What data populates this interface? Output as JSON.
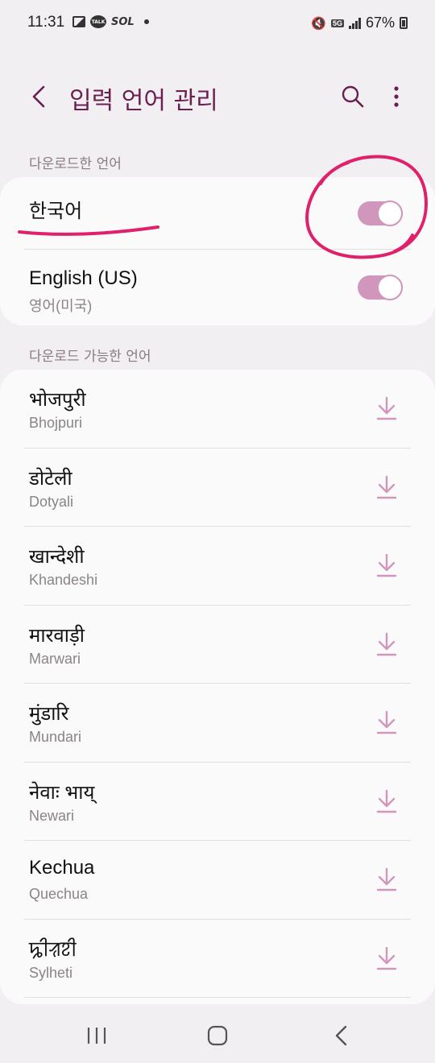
{
  "status_bar": {
    "time": "11:31",
    "left_icons": [
      "image-icon",
      "kakaotalk-icon",
      "sol-icon",
      "dot-icon"
    ],
    "talk_label": "TALK",
    "sol_label": "SOL",
    "network_label": "5G",
    "battery": "67%"
  },
  "header": {
    "title": "입력 언어 관리",
    "back_icon": "chevron-left-icon",
    "search_icon": "search-icon",
    "more_icon": "more-vertical-icon"
  },
  "downloaded": {
    "section_label": "다운로드한 언어",
    "items": [
      {
        "title": "한국어",
        "subtitle": "",
        "enabled": true
      },
      {
        "title": "English (US)",
        "subtitle": "영어(미국)",
        "enabled": true
      }
    ]
  },
  "available": {
    "section_label": "다운로드 가능한 언어",
    "items": [
      {
        "title": "भोजपुरी",
        "subtitle": "Bhojpuri"
      },
      {
        "title": "डोटेली",
        "subtitle": "Dotyali"
      },
      {
        "title": "खान्देशी",
        "subtitle": "Khandeshi"
      },
      {
        "title": "मारवाड़ी",
        "subtitle": "Marwari"
      },
      {
        "title": "मुंडारि",
        "subtitle": "Mundari"
      },
      {
        "title": "नेवाः भाय्",
        "subtitle": "Newari"
      },
      {
        "title": "Kechua",
        "subtitle": "Quechua"
      },
      {
        "title": "ꠍꠤꠟꠐꠤ",
        "subtitle": "Sylheti"
      }
    ]
  },
  "colors": {
    "accent": "#6b1f4f",
    "toggle_on": "#d196bb",
    "download_icon": "#d196bb",
    "annotation": "#e0206a"
  },
  "nav": {
    "recents_icon": "recents-icon",
    "home_icon": "home-icon",
    "back_icon": "back-icon"
  }
}
